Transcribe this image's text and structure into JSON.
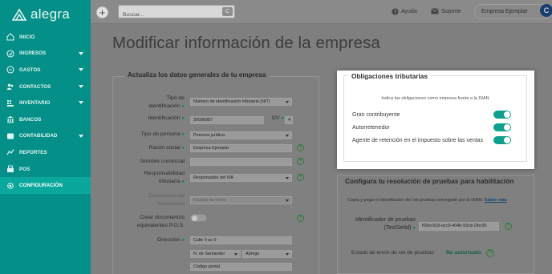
{
  "brand": {
    "name": "alegra"
  },
  "sidebar": {
    "items": [
      {
        "label": "INICIO",
        "icon": "home-icon",
        "caret": false
      },
      {
        "label": "INGRESOS",
        "icon": "income-icon",
        "caret": true
      },
      {
        "label": "GASTOS",
        "icon": "expenses-icon",
        "caret": true
      },
      {
        "label": "CONTACTOS",
        "icon": "contacts-icon",
        "caret": true
      },
      {
        "label": "INVENTARIO",
        "icon": "inventory-icon",
        "caret": true
      },
      {
        "label": "BANCOS",
        "icon": "bank-icon",
        "caret": false
      },
      {
        "label": "CONTABILIDAD",
        "icon": "accounting-icon",
        "caret": true
      },
      {
        "label": "REPORTES",
        "icon": "reports-icon",
        "caret": false
      },
      {
        "label": "POS",
        "icon": "pos-icon",
        "caret": false
      },
      {
        "label": "CONFIGURACIÓN",
        "icon": "gear-icon",
        "caret": false,
        "active": true
      }
    ]
  },
  "topbar": {
    "plus": "+",
    "search_placeholder": "Buscar...",
    "search_button": "C",
    "help": "Ayuda",
    "support": "Soporte",
    "company": "Empresa Ejemplar",
    "avatar": "C"
  },
  "page": {
    "title": "Modificar información de la empresa"
  },
  "general": {
    "title": "Actualiza los datos generales de tu empresa",
    "id_type_label_1": "Tipo de",
    "id_type_label_2": "identificación",
    "id_type_value": "Número de identificación tributaria (NIT)",
    "id_label": "Identificación",
    "id_value": "30098987",
    "dv_label": "DV",
    "dv_value": "4",
    "person_type_label": "Tipo de persona",
    "person_type_value": "Persona jurídica",
    "business_name_label": "Razón social",
    "business_name_value": "Empresa  Ejemplar",
    "trade_name_label": "Nombre comercial",
    "trade_name_value": "",
    "resp_label_1": "Responsabilidad",
    "resp_label_2": "tributaria",
    "resp_value": "Responsable del IVA",
    "doc_label_1": "Documento de",
    "doc_label_2": "facturación",
    "doc_value": "Factura de venta",
    "pos_label_1": "Crear documentos",
    "pos_label_2": "equivalentes P.O.S.",
    "address_label": "Dirección",
    "address_value": "Calle 0 av 0",
    "department_value": "N. de Santander",
    "city_value": "Abrego",
    "postal_placeholder": "Código postal"
  },
  "obligations": {
    "title": "Obligaciones tributarias",
    "subtitle": "Indica tus obligaciones como empresa frente a la DIAN",
    "items": [
      {
        "label": "Gran contribuyente",
        "on": true
      },
      {
        "label": "Autorretenedor",
        "on": true
      },
      {
        "label": "Agente de retención en el impuesto sobre las ventas",
        "on": true
      }
    ]
  },
  "testset": {
    "title": "Configura tu resolución de pruebas para habilitación",
    "desc": "Copia y pega el identificador del set pruebas entregado por la DIAN.",
    "link": "Saber más",
    "id_label_1": "Identificador de pruebas",
    "id_label_2": "(TestSetId)",
    "id_value": "f00ec918-acc9-404b-93cd-1fbc95",
    "status_label": "Estado de envío de set de pruebas:",
    "status_value": "No autorizado"
  },
  "colors": {
    "sidebar": "#049088",
    "active": "#0aa79d",
    "toggle_on": "#0e9f8e"
  }
}
